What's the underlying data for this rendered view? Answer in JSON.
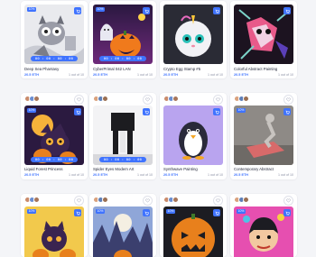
{
  "colors": {
    "accent": "#3f73ff",
    "background": "#f4f5f8",
    "card": "#ffffff",
    "muted": "#8a8fa3"
  },
  "cards": [
    {
      "badge": "10%",
      "timer": "00 : 00 : 00 : 00",
      "title": "Deep Sea Phantasy",
      "price": "20.5 ETH",
      "stock": "1 out of 10",
      "icon_cart": "cart-icon"
    },
    {
      "badge": "10%",
      "timer": "00 : 00 : 00 : 00",
      "title": "CyberPrimal 042 LAN",
      "price": "20.5 ETH",
      "stock": "1 out of 10",
      "icon_cart": "cart-icon"
    },
    {
      "badge": "10%",
      "timer": "00 : 00 : 00 : 00",
      "title": "Crypto Egg Stamp #5",
      "price": "20.5 ETH",
      "stock": "1 out of 10",
      "icon_cart": "cart-icon"
    },
    {
      "badge": "10%",
      "timer": "00 : 00 : 00 : 00",
      "title": "Colorful Abstract Painting",
      "price": "20.5 ETH",
      "stock": "1 out of 10",
      "icon_cart": "cart-icon"
    },
    {
      "badge": "10%",
      "timer": "00 : 00 : 00 : 00",
      "title": "Liquid Forest Princess",
      "price": "20.5 ETH",
      "stock": "1 out of 10",
      "icon_cart": "cart-icon"
    },
    {
      "badge": "10%",
      "timer": "00 : 00 : 00 : 00",
      "title": "Spider Eyes Modern Art",
      "price": "20.5 ETH",
      "stock": "1 out of 10",
      "icon_cart": "cart-icon"
    },
    {
      "badge": "10%",
      "timer": "00 : 00 : 00 : 00",
      "title": "Synthwave Painting",
      "price": "20.5 ETH",
      "stock": "1 out of 10",
      "icon_cart": "cart-icon"
    },
    {
      "badge": "10%",
      "timer": "00 : 00 : 00 : 00",
      "title": "Contemporary Abstract",
      "price": "20.5 ETH",
      "stock": "1 out of 10",
      "icon_cart": "cart-icon"
    },
    {
      "badge": "10%",
      "timer": "",
      "title": "",
      "price": "",
      "stock": "",
      "icon_cart": "cart-icon"
    },
    {
      "badge": "10%",
      "timer": "",
      "title": "",
      "price": "",
      "stock": "",
      "icon_cart": "cart-icon"
    },
    {
      "badge": "10%",
      "timer": "",
      "title": "",
      "price": "",
      "stock": "",
      "icon_cart": "cart-icon"
    },
    {
      "badge": "10%",
      "timer": "",
      "title": "",
      "price": "",
      "stock": "",
      "icon_cart": "cart-icon"
    }
  ]
}
